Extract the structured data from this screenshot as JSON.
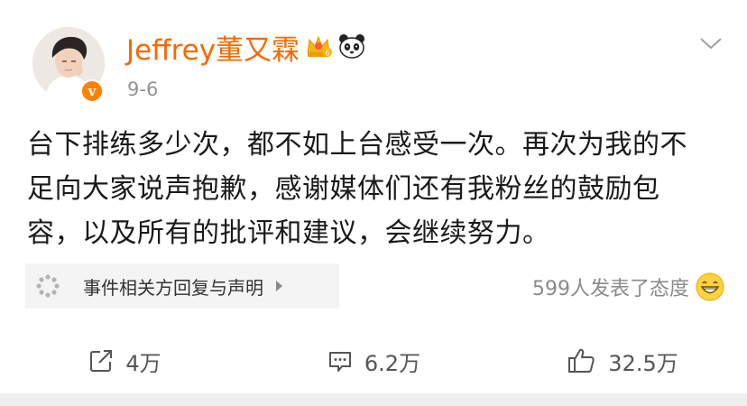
{
  "post": {
    "username": "Jeffrey董又霖",
    "time": "9-6",
    "text": "台下排练多少次，都不如上台感受一次。再次为我的不足向大家说声抱歉，感谢媒体们还有我粉丝的鼓励包容，以及所有的批评和建议，会继续努力。",
    "verified_label": "v",
    "membership_level": "6"
  },
  "event": {
    "label": "事件相关方回复与声明",
    "icon": "event-dots-icon"
  },
  "reactions": {
    "count_text": "599人发表了态度",
    "icon": "grin-emoji-icon"
  },
  "actions": {
    "repost": {
      "icon": "share-icon",
      "count": "4万"
    },
    "comment": {
      "icon": "comment-icon",
      "count": "6.2万"
    },
    "like": {
      "icon": "thumbs-up-icon",
      "count": "32.5万"
    }
  },
  "colors": {
    "username": "#f86800",
    "verified_badge": "#ff8200",
    "text": "#1a1a1a",
    "muted": "#939393"
  }
}
